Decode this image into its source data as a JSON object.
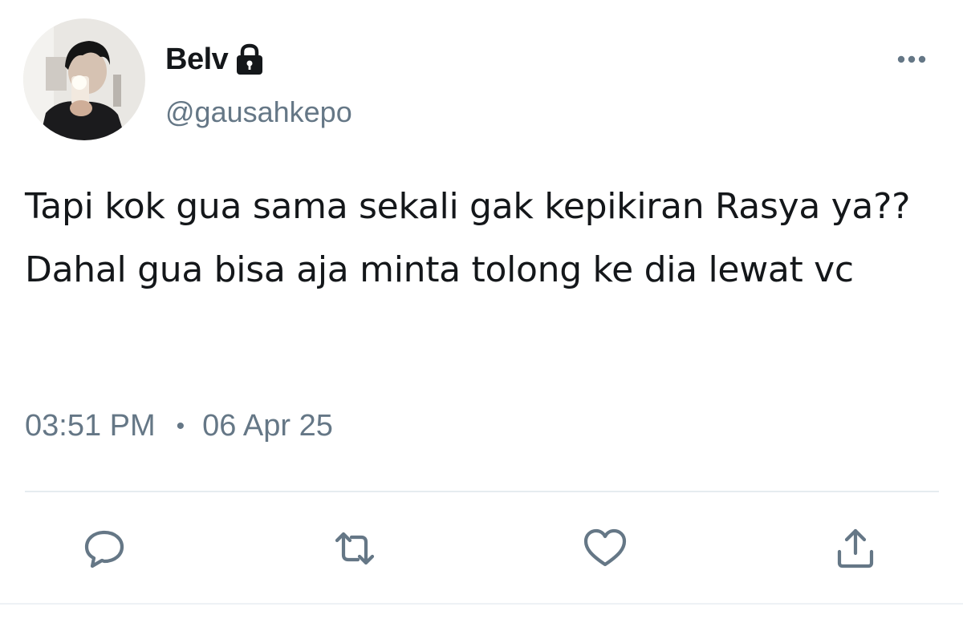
{
  "tweet": {
    "display_name": "Belv",
    "protected_icon": "lock-icon",
    "handle": "@gausahkepo",
    "text": "Tapi kok gua sama sekali gak kepikiran Rasya ya?? Dahal gua bisa aja minta tolong ke dia lewat vc",
    "time": "03:51 PM",
    "separator": "•",
    "date": "06 Apr 25"
  },
  "actions": {
    "reply_icon": "speech-bubble-icon",
    "retweet_icon": "retweet-arrows-icon",
    "like_icon": "heart-icon",
    "share_icon": "share-upload-icon",
    "more_icon": "three-dots-icon"
  },
  "colors": {
    "primary_text": "#14171a",
    "secondary_text": "#657786",
    "divider": "#e6ecf0"
  }
}
